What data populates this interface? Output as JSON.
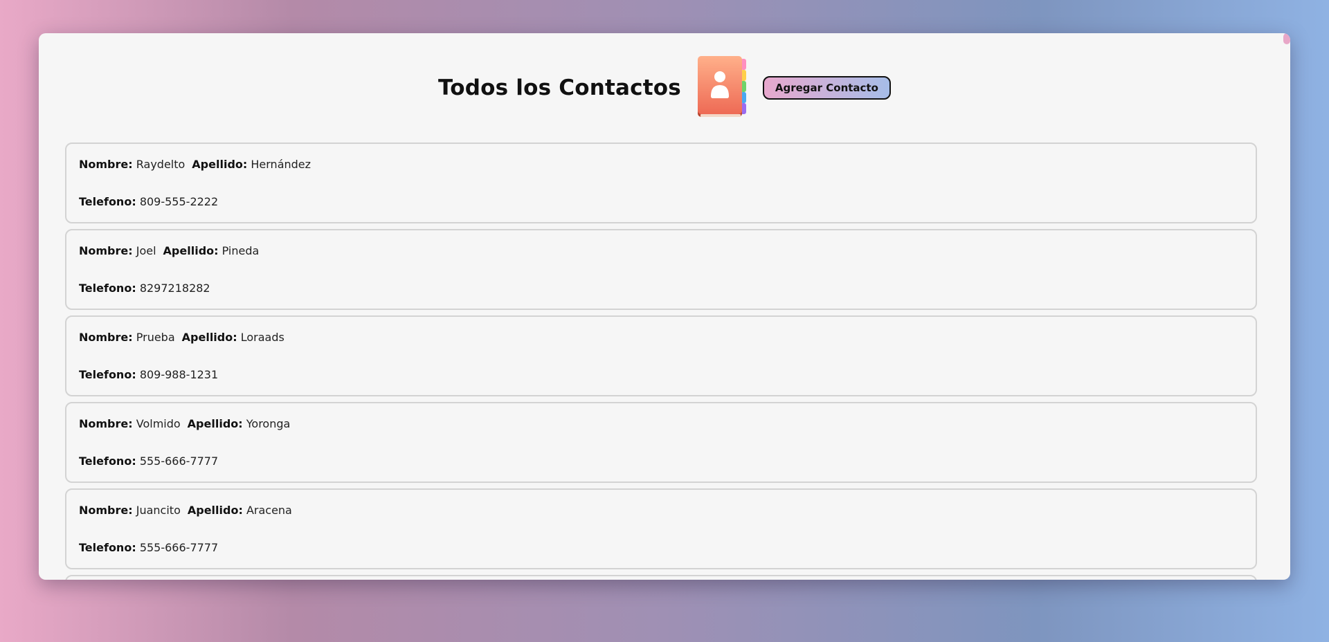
{
  "header": {
    "title": "Todos los Contactos",
    "add_button_label": "Agregar Contacto",
    "icon": "contact-book-icon"
  },
  "labels": {
    "nombre": "Nombre:",
    "apellido": "Apellido:",
    "telefono": "Telefono:"
  },
  "contacts": [
    {
      "nombre": "Raydelto",
      "apellido": "Hernández",
      "telefono": "809-555-2222"
    },
    {
      "nombre": "Joel",
      "apellido": "Pineda",
      "telefono": "8297218282"
    },
    {
      "nombre": "Prueba",
      "apellido": "Loraads",
      "telefono": "809-988-1231"
    },
    {
      "nombre": "Volmido",
      "apellido": "Yoronga",
      "telefono": "555-666-7777"
    },
    {
      "nombre": "Juancito",
      "apellido": "Aracena",
      "telefono": "555-666-7777"
    }
  ],
  "colors": {
    "button_gradient_start": "#e8a8cd",
    "button_gradient_end": "#a6bde8",
    "card_background": "#f6f6f6"
  }
}
